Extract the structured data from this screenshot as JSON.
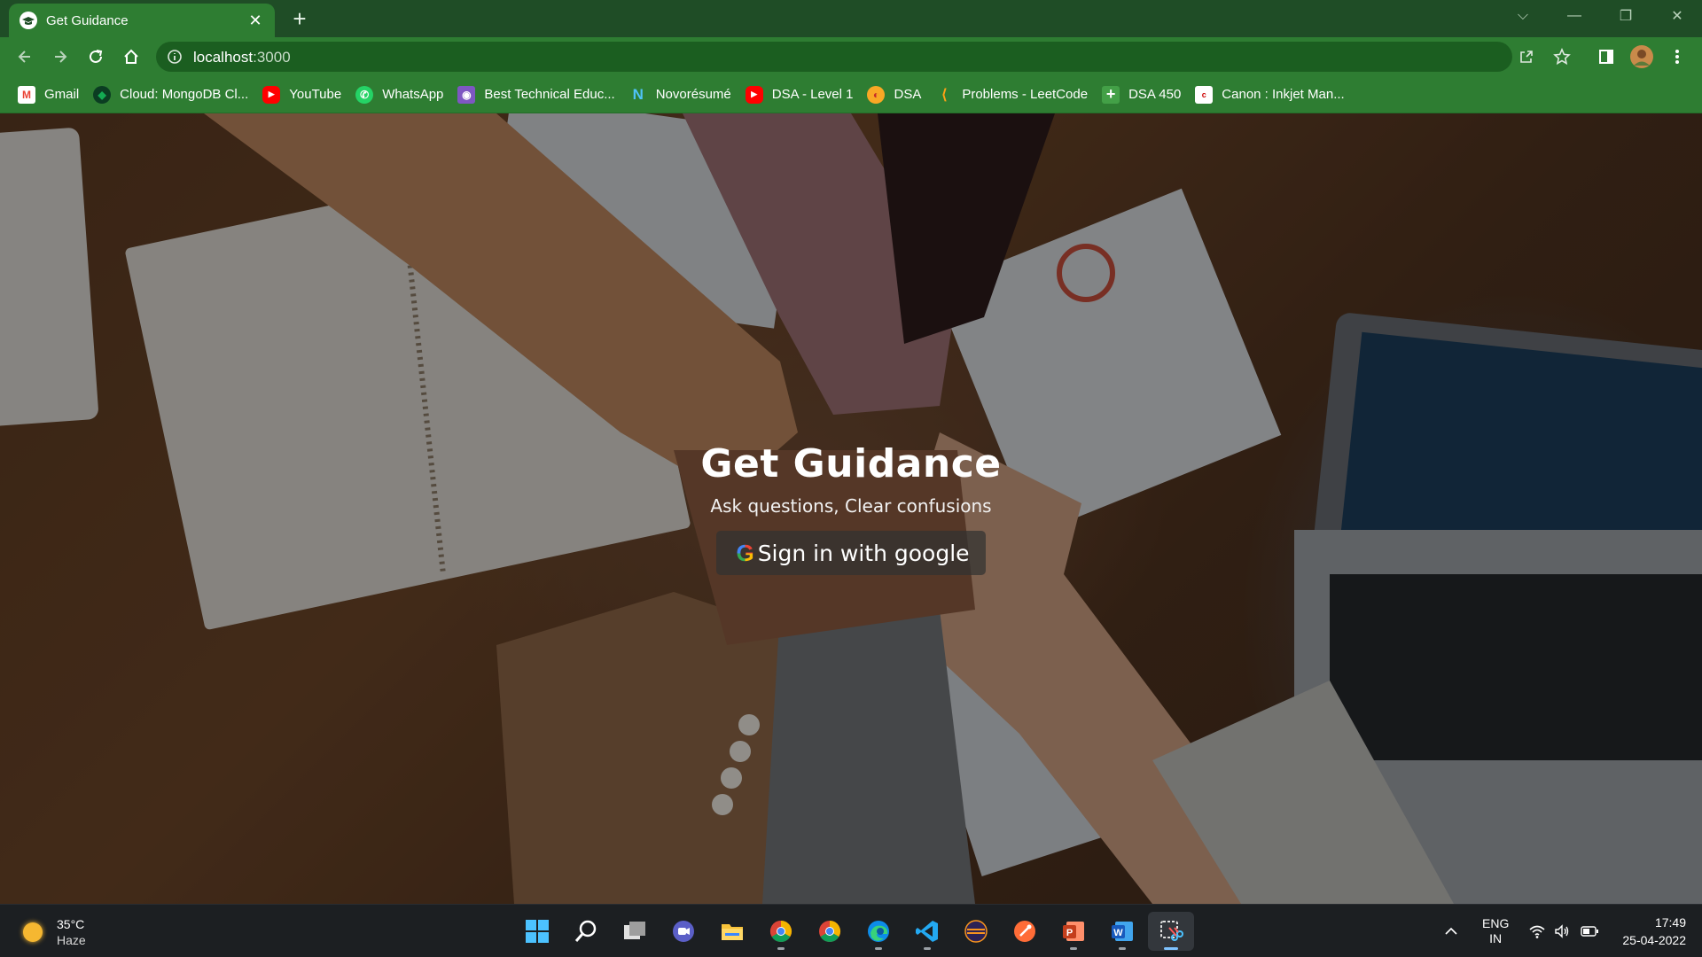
{
  "browser": {
    "tab_title": "Get Guidance",
    "close_symbol": "✕",
    "newtab_symbol": "+",
    "url_host": "localhost",
    "url_port": ":3000",
    "window_controls": {
      "tabsearch": "⌵",
      "minimize": "—",
      "restore": "❐",
      "close": "✕"
    }
  },
  "bookmarks": [
    {
      "label": "Gmail",
      "icon": "gmail-icon",
      "color": "#ea4335",
      "glyph": "M"
    },
    {
      "label": "Cloud: MongoDB Cl...",
      "icon": "mongodb-icon",
      "color": "#13aa52",
      "glyph": "◆"
    },
    {
      "label": "YouTube",
      "icon": "youtube-icon",
      "color": "#ff0000",
      "glyph": "▶"
    },
    {
      "label": "WhatsApp",
      "icon": "whatsapp-icon",
      "color": "#25d366",
      "glyph": "✆"
    },
    {
      "label": "Best Technical Educ...",
      "icon": "education-icon",
      "color": "#7e57c2",
      "glyph": "◉"
    },
    {
      "label": "Novorésumé",
      "icon": "novoresume-icon",
      "color": "#1e88e5",
      "glyph": "N"
    },
    {
      "label": "DSA - Level 1",
      "icon": "youtube-icon",
      "color": "#ff0000",
      "glyph": "▶"
    },
    {
      "label": "DSA",
      "icon": "dsa-icon",
      "color": "#f9a825",
      "glyph": "◐"
    },
    {
      "label": "Problems - LeetCode",
      "icon": "leetcode-icon",
      "color": "#333333",
      "glyph": "⟨"
    },
    {
      "label": "DSA 450",
      "icon": "dsa450-icon",
      "color": "#2e7d32",
      "glyph": "+"
    },
    {
      "label": "Canon : Inkjet Man...",
      "icon": "canon-icon",
      "color": "#ffffff",
      "glyph": "c"
    }
  ],
  "page": {
    "heading": "Get Guidance",
    "subheading": "Ask questions, Clear confusions",
    "signin_logo": "G",
    "signin_label": "Sign in with google"
  },
  "taskbar": {
    "weather_temp": "35°C",
    "weather_desc": "Haze",
    "lang_top": "ENG",
    "lang_bottom": "IN",
    "time": "17:49",
    "date": "25-04-2022",
    "apps": [
      {
        "name": "start-icon",
        "running": false
      },
      {
        "name": "search-icon",
        "running": false
      },
      {
        "name": "task-view-icon",
        "running": false
      },
      {
        "name": "teams-chat-icon",
        "running": false
      },
      {
        "name": "file-explorer-icon",
        "running": false
      },
      {
        "name": "chrome-icon",
        "running": true
      },
      {
        "name": "chrome-profile-icon",
        "running": false
      },
      {
        "name": "edge-icon",
        "running": true
      },
      {
        "name": "vscode-icon",
        "running": true
      },
      {
        "name": "eclipse-icon",
        "running": false
      },
      {
        "name": "postman-icon",
        "running": false
      },
      {
        "name": "powerpoint-icon",
        "running": true
      },
      {
        "name": "word-icon",
        "running": true
      },
      {
        "name": "snipping-tool-icon",
        "running": true,
        "active": true
      }
    ]
  }
}
